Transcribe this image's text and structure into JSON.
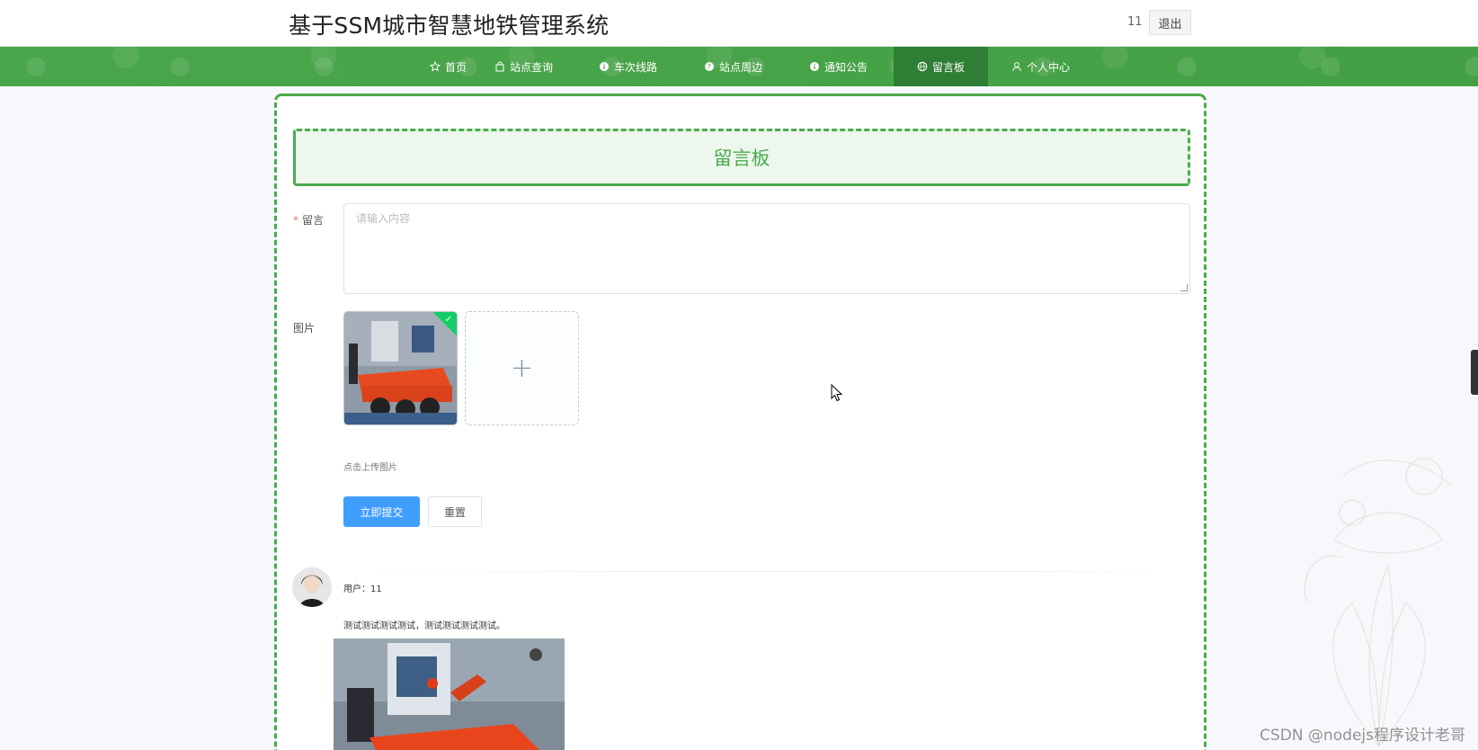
{
  "header": {
    "title": "基于SSM城市智慧地铁管理系统",
    "username": "11",
    "logout_label": "退出"
  },
  "nav": {
    "items": [
      {
        "label": "首页",
        "icon": "star-icon"
      },
      {
        "label": "站点查询",
        "icon": "bag-icon"
      },
      {
        "label": "车次线路",
        "icon": "info-icon"
      },
      {
        "label": "站点周边",
        "icon": "question-icon"
      },
      {
        "label": "通知公告",
        "icon": "info-icon"
      },
      {
        "label": "留言板",
        "icon": "globe-icon"
      },
      {
        "label": "个人中心",
        "icon": "user-icon"
      }
    ],
    "active_index": 5
  },
  "board": {
    "title": "留言板",
    "message_label": "留言",
    "message_placeholder": "请输入内容",
    "image_label": "图片",
    "upload_tip": "点击上传图片",
    "submit_label": "立即提交",
    "reset_label": "重置"
  },
  "comment": {
    "user_line": "用户：11",
    "text": "测试测试测试测试，测试测试测试测试。"
  },
  "watermark": "CSDN @nodejs程序设计老哥",
  "colors": {
    "accent": "#4cab4c",
    "nav_bg": "#47a447",
    "nav_active": "#2f7e35",
    "primary_button": "#409eff"
  }
}
